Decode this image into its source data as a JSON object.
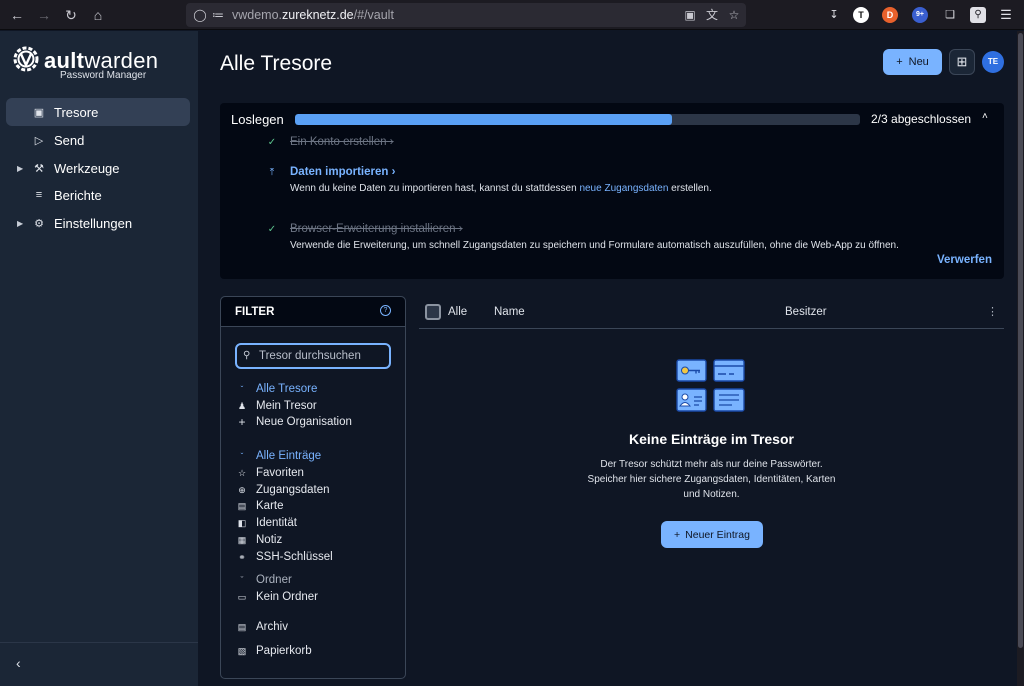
{
  "browser": {
    "url_host": "vwdemo.",
    "url_domain": "zureknetz.de",
    "url_path": "/#/vault",
    "ext_badge": "9+"
  },
  "sidebar": {
    "brand_v": "V",
    "brand_bold": "ault",
    "brand_rest": "warden",
    "brand_sub": "Password Manager",
    "items": [
      {
        "label": "Tresore",
        "icon": "vault-icon"
      },
      {
        "label": "Send",
        "icon": "send-icon"
      },
      {
        "label": "Werkzeuge",
        "icon": "wrench-icon"
      },
      {
        "label": "Berichte",
        "icon": "sliders-icon"
      },
      {
        "label": "Einstellungen",
        "icon": "gear-icon"
      }
    ]
  },
  "header": {
    "title": "Alle Tresore",
    "new_label": "Neu",
    "avatar": "TE"
  },
  "getting_started": {
    "label": "Loslegen",
    "progress": 0.667,
    "status": "2/3 abgeschlossen",
    "steps": [
      {
        "title": "Ein Konto erstellen",
        "done": true
      },
      {
        "title": "Daten importieren",
        "done": false,
        "desc_pre": "Wenn du keine Daten zu importieren hast, kannst du stattdessen ",
        "desc_link": "neue Zugangsdaten",
        "desc_post": " erstellen."
      },
      {
        "title": "Browser-Erweiterung installieren",
        "done": true,
        "desc": "Verwende die Erweiterung, um schnell Zugangsdaten zu speichern und Formulare automatisch auszufüllen, ohne die Web-App zu öffnen."
      }
    ],
    "dismiss": "Verwerfen"
  },
  "filter": {
    "title": "FILTER",
    "search_placeholder": "Tresor durchsuchen",
    "vaults_header": "Alle Tresore",
    "my_vault": "Mein Tresor",
    "new_org": "Neue Organisation",
    "items_header": "Alle Einträge",
    "types": [
      "Favoriten",
      "Zugangsdaten",
      "Karte",
      "Identität",
      "Notiz",
      "SSH-Schlüssel"
    ],
    "folders_header": "Ordner",
    "no_folder": "Kein Ordner",
    "archive": "Archiv",
    "trash": "Papierkorb"
  },
  "table": {
    "col_all": "Alle",
    "col_name": "Name",
    "col_owner": "Besitzer"
  },
  "empty": {
    "title": "Keine Einträge im Tresor",
    "line1": "Der Tresor schützt mehr als nur deine Passwörter.",
    "line2": "Speicher hier sichere Zugangsdaten, Identitäten, Karten",
    "line3": "und Notizen.",
    "button": "Neuer Eintrag"
  },
  "colors": {
    "accent": "#79b3ff",
    "sidebar": "#1b2636",
    "background": "#0f1624"
  }
}
